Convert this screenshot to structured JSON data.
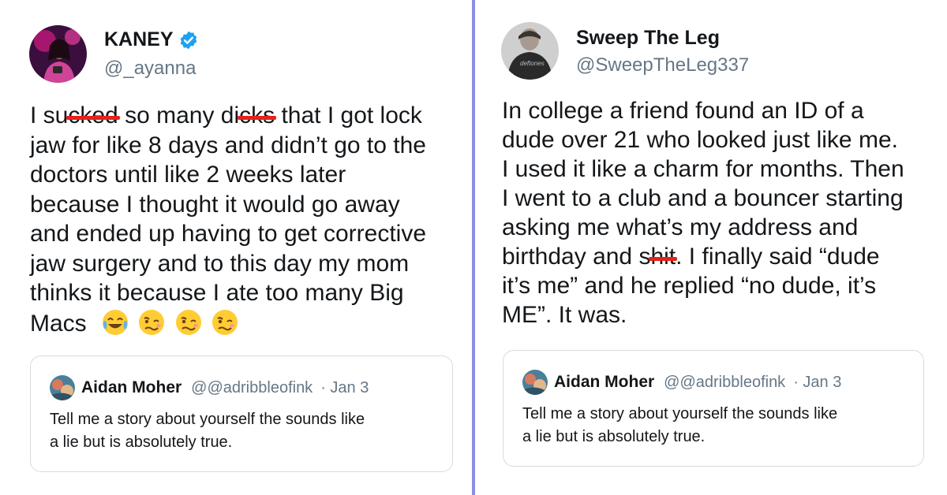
{
  "left_tweet": {
    "author_name": "KANEY",
    "author_handle": "@_ayanna",
    "verified": true,
    "body": {
      "l1_a": "I su",
      "l1_c1": "cked",
      "l1_b": " so many di",
      "l1_c2": "cks",
      "l1_d": " that I got lock",
      "l2": "jaw for like 8 days and didn’t go to the",
      "l3": "doctors until like 2 weeks later",
      "l4": "because I thought it would go away",
      "l5": "and ended up having to get corrective",
      "l6": "jaw surgery and to this day my mom",
      "l7": "thinks it because I ate too many Big",
      "l8": "Macs"
    },
    "emojis": [
      "face-with-tears-of-joy-emoji",
      "woozy-face-emoji",
      "woozy-face-emoji",
      "woozy-face-emoji"
    ],
    "quote": {
      "author_name": "Aidan Moher",
      "author_handle": "@@adribbleofink",
      "date": "· Jan 3",
      "text_l1": "Tell me a story about yourself the sounds like",
      "text_l2": "a lie but is absolutely true."
    }
  },
  "right_tweet": {
    "author_name": "Sweep The Leg",
    "author_handle": "@SweepTheLeg337",
    "verified": false,
    "body": {
      "l1": "In college a friend found an ID of a",
      "l2": "dude over 21 who looked just like me.",
      "l3": "I used it like a charm for months. Then",
      "l4": "I went to a club and a bouncer starting",
      "l5": "asking me what’s my address and",
      "l6_a": "birthday and s",
      "l6_c": "hit",
      "l6_b": ". I finally said “dude",
      "l7": "it’s me” and he replied “no dude, it’s",
      "l8": "ME”. It was."
    },
    "quote": {
      "author_name": "Aidan Moher",
      "author_handle": "@@adribbleofink",
      "date": "· Jan 3",
      "text_l1": "Tell me a story about yourself the sounds like",
      "text_l2": "a lie but is absolutely true."
    }
  },
  "colors": {
    "divider": "#8d8ce6",
    "verified_blue": "#1da1f2",
    "censor_red": "#e6211b",
    "handle_gray": "#657786"
  }
}
